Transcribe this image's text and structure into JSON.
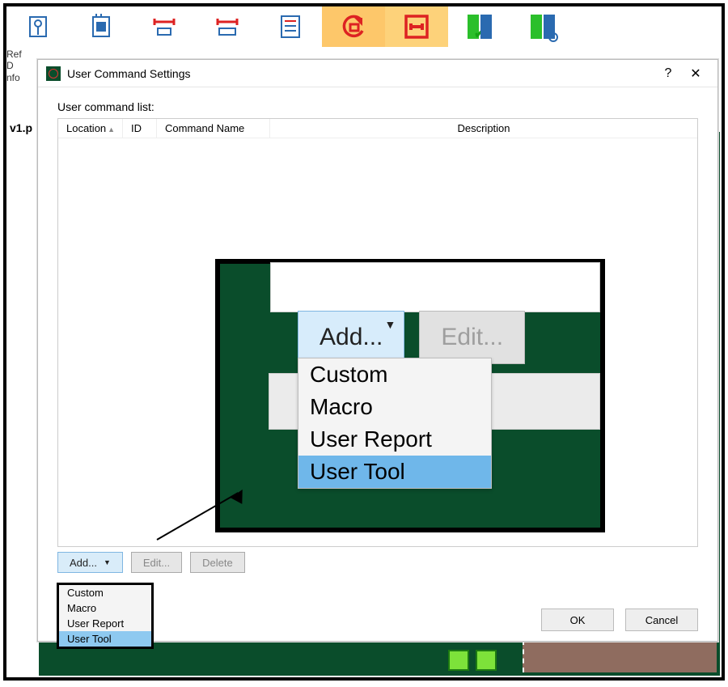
{
  "ribbon": {
    "sidelabels": "Ref\nD\nnfo",
    "items": [
      {
        "name": "refresh"
      },
      {
        "name": "chip"
      },
      {
        "name": "span-a"
      },
      {
        "name": "span-b"
      },
      {
        "name": "sheet"
      },
      {
        "name": "undo-red",
        "hl": "hl1"
      },
      {
        "name": "box-red",
        "hl": "hl2"
      },
      {
        "name": "diff-check"
      },
      {
        "name": "diff-find"
      }
    ]
  },
  "crumb": "v1.p",
  "dialog": {
    "title": "User Command Settings",
    "list_label": "User command list:",
    "columns": {
      "location": "Location",
      "id": "ID",
      "name": "Command Name",
      "desc": "Description"
    },
    "buttons": {
      "add": "Add...",
      "edit": "Edit...",
      "delete": "Delete"
    },
    "ok": "OK",
    "cancel": "Cancel"
  },
  "add_menu": {
    "items": [
      "Custom",
      "Macro",
      "User Report",
      "User Tool"
    ],
    "selected_index": 3
  },
  "zoom": {
    "add": "Add...",
    "edit": "Edit..."
  }
}
